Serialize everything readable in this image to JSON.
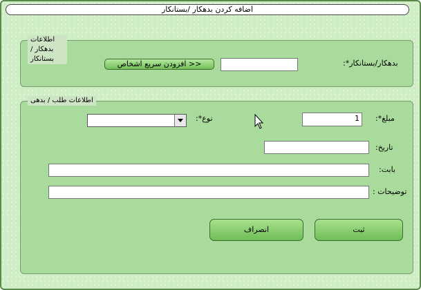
{
  "window": {
    "title": "اضافه کردن بدهکار /بستانکار"
  },
  "group1": {
    "title": "اطلاعات بدهکار / بستانکار",
    "label": "بدهکار/بستانکار*:",
    "input_value": "",
    "quick_add_button": "افزودن سریع اشخاص >>"
  },
  "group2": {
    "title": "اطلاعات طلب / بدهی",
    "amount_label": "مبلغ*:",
    "amount_value": "1",
    "type_label": "نوع*:",
    "type_value": "",
    "date_label": "تاریخ:",
    "date_value": "",
    "reason_label": "بابت:",
    "reason_value": "",
    "desc_label": "توضیحات :",
    "desc_value": "",
    "submit_button": "ثبت",
    "cancel_button": "انصراف"
  },
  "colors": {
    "background": "#cfeec6",
    "group": "#a9dc9c",
    "button": "#73c058"
  },
  "icons": [
    "dropdown-arrow-icon",
    "mouse-pointer-icon"
  ]
}
